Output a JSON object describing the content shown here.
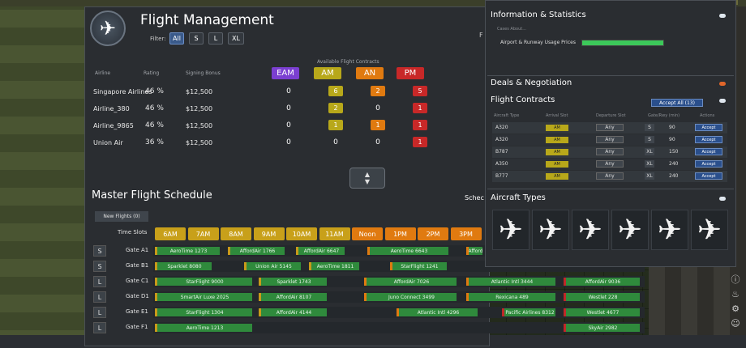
{
  "panel": {
    "title": "Flight Management",
    "filter_label": "Filter:",
    "filters": [
      "All",
      "S",
      "L",
      "XL"
    ],
    "right_edge_label": "F"
  },
  "airline_table": {
    "headers": {
      "airline": "Airline",
      "rating": "Rating",
      "signing_bonus": "Signing Bonus",
      "contracts": "Available Flight Contracts"
    },
    "slots": [
      {
        "label": "EAM",
        "color": "#7b3fd1"
      },
      {
        "label": "AM",
        "color": "#b8a81a"
      },
      {
        "label": "AN",
        "color": "#e07a10"
      },
      {
        "label": "PM",
        "color": "#c82828"
      }
    ],
    "rows": [
      {
        "airline": "Singapore Airlines",
        "rating": "46 %",
        "bonus": "$12,500",
        "counts": [
          "0",
          "6",
          "2",
          "5"
        ]
      },
      {
        "airline": "Airline_380",
        "rating": "46 %",
        "bonus": "$12,500",
        "counts": [
          "0",
          "2",
          "0",
          "1"
        ]
      },
      {
        "airline": "Airline_9865",
        "rating": "46 %",
        "bonus": "$12,500",
        "counts": [
          "0",
          "1",
          "1",
          "1"
        ]
      },
      {
        "airline": "Union Air",
        "rating": "36 %",
        "bonus": "$12,500",
        "counts": [
          "0",
          "0",
          "0",
          "1"
        ]
      }
    ]
  },
  "schedule": {
    "title": "Master Flight Schedule",
    "sched_label": "Schec",
    "new_flights": "New Flights (0)",
    "time_slots_label": "Time Slots",
    "time_slots": [
      {
        "label": "6AM",
        "color": "#c8a01a"
      },
      {
        "label": "7AM",
        "color": "#c8a01a"
      },
      {
        "label": "8AM",
        "color": "#c8a01a"
      },
      {
        "label": "9AM",
        "color": "#c8a01a"
      },
      {
        "label": "10AM",
        "color": "#c8a01a"
      },
      {
        "label": "11AM",
        "color": "#c8a01a"
      },
      {
        "label": "Noon",
        "color": "#e07a10"
      },
      {
        "label": "1PM",
        "color": "#e07a10"
      },
      {
        "label": "2PM",
        "color": "#e07a10"
      },
      {
        "label": "3PM",
        "color": "#e07a10"
      }
    ],
    "gates": [
      {
        "size": "S",
        "name": "Gate A1",
        "flights": [
          {
            "label": "AeroTime 1273",
            "mark": "yellow"
          },
          {
            "label": "AffordAir 1766",
            "mark": "yellow"
          },
          {
            "label": "AffordAir 6647",
            "mark": "yellow"
          },
          {
            "label": "AeroTime 6643",
            "mark": "orange"
          },
          {
            "label": "Afford",
            "mark": "orange"
          }
        ]
      },
      {
        "size": "S",
        "name": "Gate B1",
        "flights": [
          {
            "label": "Sparklet 8080",
            "mark": "yellow"
          },
          {
            "label": "Union Air 5145",
            "mark": "yellow"
          },
          {
            "label": "AeroTime 1811",
            "mark": "yellow"
          },
          {
            "label": "StarFlight 1241",
            "mark": "orange"
          }
        ]
      },
      {
        "size": "L",
        "name": "Gate C1",
        "flights": [
          {
            "label": "StarFlight 9000",
            "mark": "yellow"
          },
          {
            "label": "Sparklet 1743",
            "mark": "yellow"
          },
          {
            "label": "AffordAir 7026",
            "mark": "orange"
          },
          {
            "label": "Atlantic Intl 3444",
            "mark": "orange"
          },
          {
            "label": "AffordAir 9036",
            "mark": "red"
          }
        ]
      },
      {
        "size": "L",
        "name": "Gate D1",
        "flights": [
          {
            "label": "SmartAir Luxe 2025",
            "mark": "yellow"
          },
          {
            "label": "AffordAir 8107",
            "mark": "yellow"
          },
          {
            "label": "Juno Connect 3499",
            "mark": "orange"
          },
          {
            "label": "Rexicana 489",
            "mark": "orange"
          },
          {
            "label": "Westlet 228",
            "mark": "red"
          }
        ]
      },
      {
        "size": "L",
        "name": "Gate E1",
        "flights": [
          {
            "label": "StarFlight 1304",
            "mark": "yellow"
          },
          {
            "label": "AffordAir 4144",
            "mark": "yellow"
          },
          {
            "label": "Atlantic Intl 4296",
            "mark": "orange"
          },
          {
            "label": "Pacific Airlines 8312",
            "mark": "red"
          },
          {
            "label": "Westlet 4677",
            "mark": "red"
          }
        ]
      },
      {
        "size": "L",
        "name": "Gate F1",
        "flights": [
          {
            "label": "AeroTime 1213",
            "mark": "yellow"
          },
          {
            "label": "SkyAir 2982",
            "mark": "red"
          }
        ]
      }
    ]
  },
  "right_panel": {
    "info_title": "Information & Statistics",
    "case_about": "Cases About...",
    "airport_prices_label": "Airport & Runway Usage Prices",
    "airport_prices_fill": 1.0,
    "deals_title": "Deals & Negotiation",
    "contracts_title": "Flight Contracts",
    "accept_all": "Accept All (13)",
    "contract_headers": [
      "Aircraft Type",
      "Arrival Slot",
      "Departure Slot",
      "Gate/Rwy (min)",
      "Actions"
    ],
    "contracts": [
      {
        "type": "A320",
        "arrival": "AM",
        "departure": "Any",
        "size": "S",
        "minutes": "90",
        "action": "Accept"
      },
      {
        "type": "A320",
        "arrival": "AM",
        "departure": "Any",
        "size": "S",
        "minutes": "90",
        "action": "Accept"
      },
      {
        "type": "B787",
        "arrival": "AM",
        "departure": "Any",
        "size": "XL",
        "minutes": "150",
        "action": "Accept"
      },
      {
        "type": "A350",
        "arrival": "AM",
        "departure": "Any",
        "size": "XL",
        "minutes": "240",
        "action": "Accept"
      },
      {
        "type": "B777",
        "arrival": "AM",
        "departure": "Any",
        "size": "XL",
        "minutes": "240",
        "action": "Accept"
      }
    ],
    "aircraft_title": "Aircraft Types",
    "aircraft_count": 6
  },
  "icons": {
    "logo": "airplane-icon",
    "aircraft": "airplane-icon",
    "scroll": "chevron-up-down-icon"
  }
}
